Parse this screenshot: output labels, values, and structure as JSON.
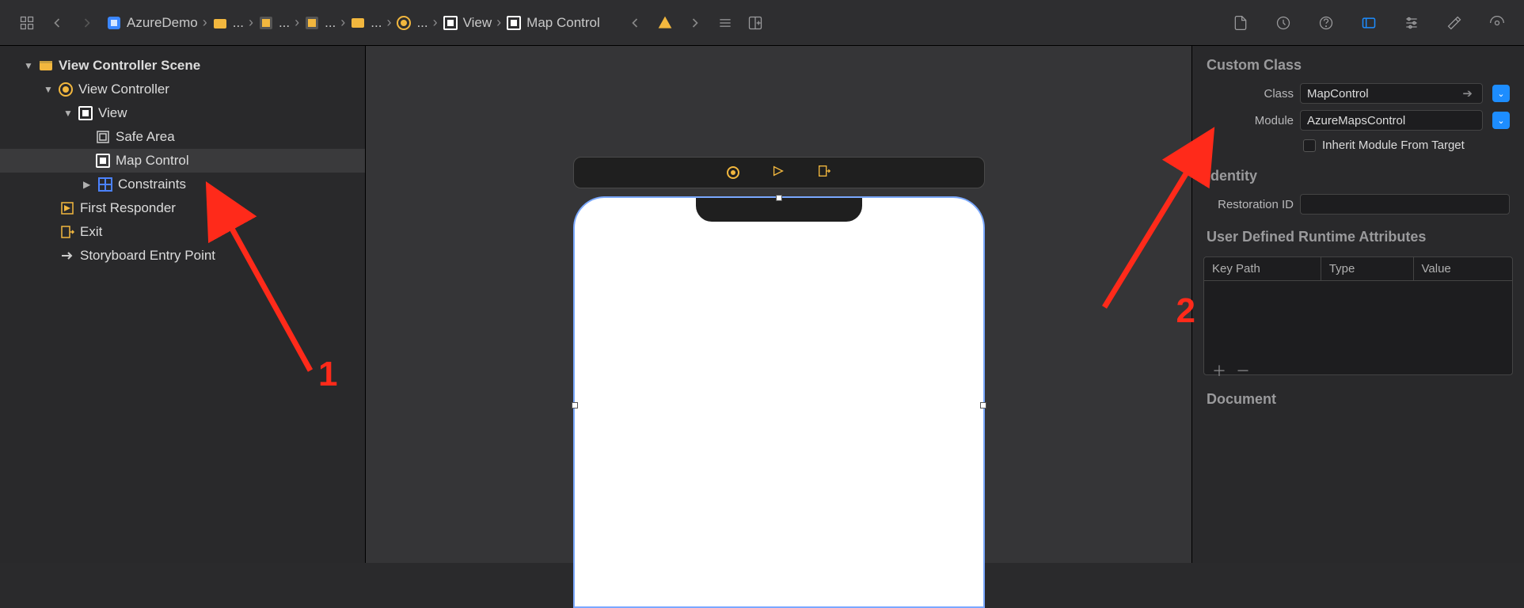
{
  "toolbar": {
    "project": "AzureDemo"
  },
  "breadcrumb": {
    "segments": [
      "AzureDemo",
      "...",
      "...",
      "...",
      "...",
      "...",
      "View",
      "Map Control"
    ]
  },
  "outline": {
    "scene": "View Controller Scene",
    "controller": "View Controller",
    "view": "View",
    "safeArea": "Safe Area",
    "mapControl": "Map Control",
    "constraints": "Constraints",
    "firstResponder": "First Responder",
    "exit": "Exit",
    "entryPoint": "Storyboard Entry Point"
  },
  "inspector": {
    "customClass": {
      "title": "Custom Class",
      "classLabel": "Class",
      "classValue": "MapControl",
      "moduleLabel": "Module",
      "moduleValue": "AzureMapsControl",
      "inheritLabel": "Inherit Module From Target"
    },
    "identity": {
      "title": "Identity",
      "restorationLabel": "Restoration ID",
      "restorationValue": ""
    },
    "runtimeAttrs": {
      "title": "User Defined Runtime Attributes",
      "cols": [
        "Key Path",
        "Type",
        "Value"
      ]
    },
    "document": {
      "title": "Document"
    }
  },
  "annotations": {
    "one": "1",
    "two": "2"
  }
}
